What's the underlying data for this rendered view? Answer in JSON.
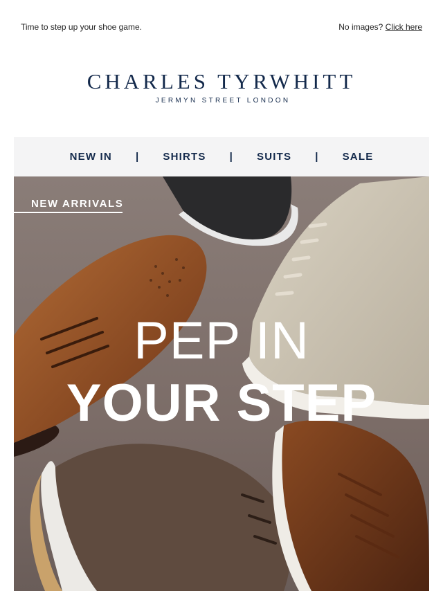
{
  "preheader": {
    "tagline": "Time to step up your shoe game.",
    "no_images_text": "No images?",
    "click_here_link": "Click here"
  },
  "logo": {
    "brand": "CHARLES TYRWHITT",
    "subtitle": "JERMYN STREET LONDON",
    "brand_color": "#13294b"
  },
  "nav": {
    "items": [
      "NEW IN",
      "SHIRTS",
      "SUITS",
      "SALE"
    ],
    "separator": "|",
    "background": "#f4f4f5"
  },
  "hero": {
    "badge": "NEW ARRIVALS",
    "headline_line1": "PEP IN",
    "headline_line2": "YOUR STEP",
    "background": "#857874"
  }
}
